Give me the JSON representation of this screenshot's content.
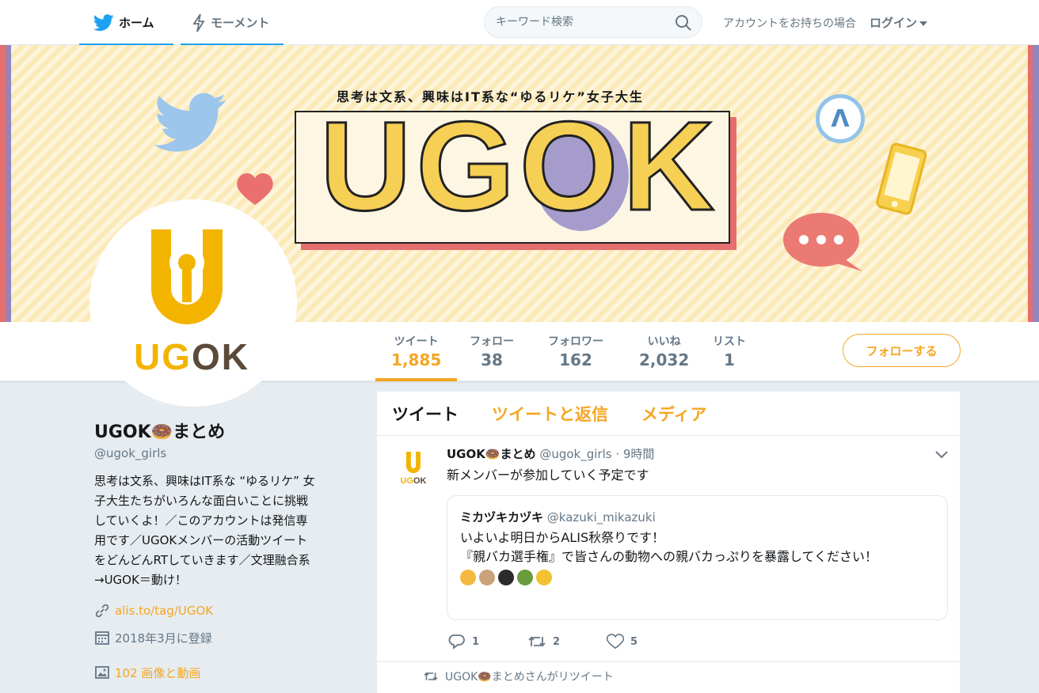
{
  "nav": {
    "home_label": "ホーム",
    "moments_label": "モーメント",
    "search_placeholder": "キーワード検索",
    "account_prompt": "アカウントをお持ちの場合",
    "login_label": "ログイン"
  },
  "banner": {
    "tagline": "思考は文系、興味はIT系な“ゆるリケ”女子大生",
    "logo_text": "UGOK"
  },
  "avatar": {
    "logo_text": "UGOK"
  },
  "stats": [
    {
      "label": "ツイート",
      "value": "1,885"
    },
    {
      "label": "フォロー",
      "value": "38"
    },
    {
      "label": "フォロワー",
      "value": "162"
    },
    {
      "label": "いいね",
      "value": "2,032"
    },
    {
      "label": "リスト",
      "value": "1"
    }
  ],
  "follow_button": "フォローする",
  "profile": {
    "display_name": "UGOK🍩まとめ",
    "handle": "@ugok_girls",
    "bio": "思考は文系、興味はIT系な “ゆるリケ” 女\n子大生たちがいろんな面白いことに挑戦\nしていくよ！／このアカウントは発信専\n用です／UGOKメンバーの活動ツイート\nをどんどんRTしていきます／文理融合系\n→UGOK＝動け！",
    "link": "alis.to/tag/UGOK",
    "joined": "2018年3月に登録",
    "media": "102 画像と動画"
  },
  "tabs": [
    "ツイート",
    "ツイートと返信",
    "メディア"
  ],
  "tweet": {
    "name": "UGOK🍩まとめ",
    "handle": "@ugok_girls",
    "time": "· 9時間",
    "text": "新メンバーが参加していく予定です",
    "quote": {
      "name": "ミカヅキカヅキ",
      "handle": "@kazuki_mikazuki",
      "text": "いよいよ明日からALIS秋祭りです！\n『親バカ選手権』で皆さんの動物への親バカっぷりを暴露してください！"
    },
    "replies": "1",
    "retweets": "2",
    "likes": "5"
  },
  "retweet_context": "UGOK🍩まとめさんがリツイート",
  "colors": {
    "accent": "#f5a623",
    "twitter_blue": "#1da1f2",
    "banner_bg": "#fbe9b6"
  }
}
